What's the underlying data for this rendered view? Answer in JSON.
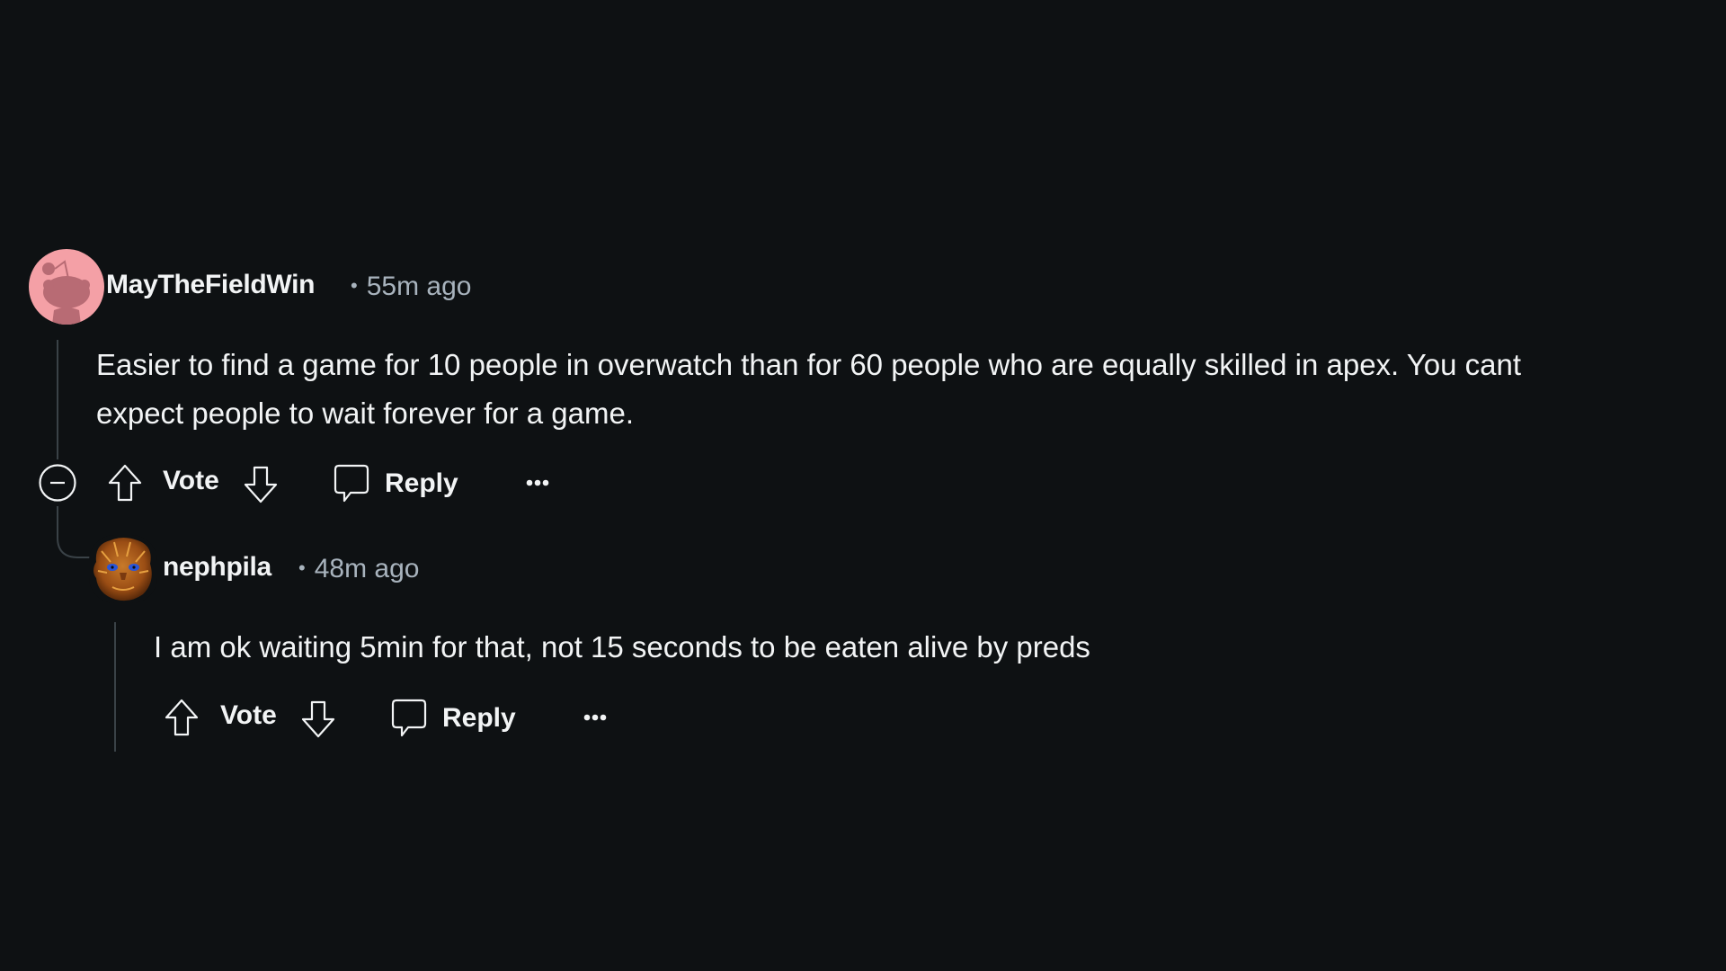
{
  "comments": [
    {
      "author": "MayTheFieldWin",
      "separator": "•",
      "timestamp": "55m ago",
      "avatar": "reddit-snoo-avatar-pink",
      "body_lines": [
        "Easier to find a game for 10 people in overwatch than for 60 people who are equally skilled in apex. You cant",
        "expect people to wait forever for a game."
      ],
      "actions": {
        "vote_label": "Vote",
        "reply_label": "Reply",
        "more": "more-options"
      },
      "collapse_icon": "minus-circle-icon"
    },
    {
      "author": "nephpila",
      "separator": "•",
      "timestamp": "48m ago",
      "avatar": "furry-creature-avatar",
      "body_lines": [
        "I am ok waiting 5min for that, not 15 seconds to be eaten alive by preds"
      ],
      "actions": {
        "vote_label": "Vote",
        "reply_label": "Reply",
        "more": "more-options"
      }
    }
  ],
  "colors": {
    "background": "#0e1113",
    "text": "#f2f4f5",
    "meta": "#a8b3bd",
    "thread_line": "#3a4247",
    "avatar_pink": "#f4a0a6"
  }
}
